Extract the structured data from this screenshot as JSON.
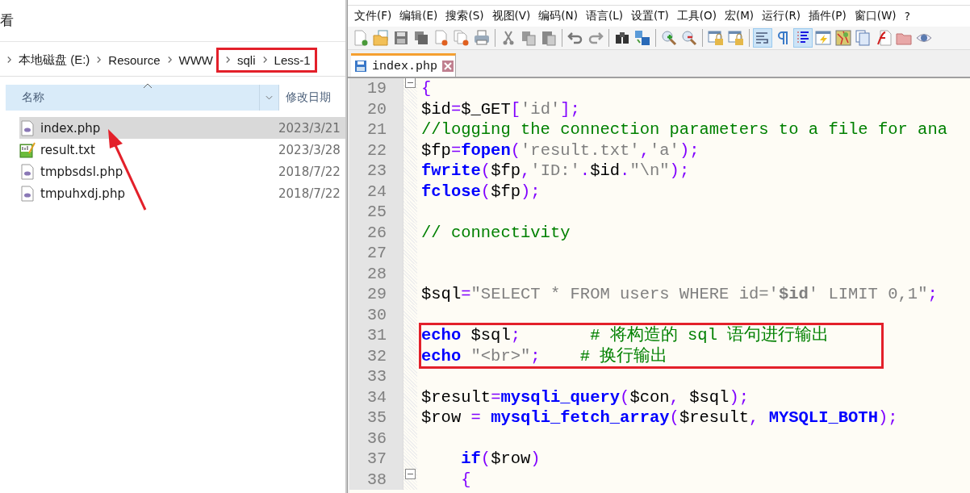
{
  "explorer": {
    "ribbon_tab": "看",
    "breadcrumb": [
      {
        "label": "本地磁盘 (E:)",
        "marked": false
      },
      {
        "label": "Resource",
        "marked": false
      },
      {
        "label": "WWW",
        "marked": false
      },
      {
        "label": "sqli",
        "marked": true
      },
      {
        "label": "Less-1",
        "marked": true
      }
    ],
    "columns": [
      "名称",
      "修改日期"
    ],
    "files": [
      {
        "name": "index.php",
        "date": "2023/3/21",
        "kind": "php",
        "selected": true,
        "pointed": true
      },
      {
        "name": "result.txt",
        "date": "2023/3/28",
        "kind": "txt",
        "selected": false,
        "pointed": false
      },
      {
        "name": "tmpbsdsl.php",
        "date": "2018/7/22",
        "kind": "php",
        "selected": false,
        "pointed": false
      },
      {
        "name": "tmpuhxdj.php",
        "date": "2018/7/22",
        "kind": "php",
        "selected": false,
        "pointed": false
      }
    ]
  },
  "editor": {
    "menu": [
      "文件(F)",
      "编辑(E)",
      "搜索(S)",
      "视图(V)",
      "编码(N)",
      "语言(L)",
      "设置(T)",
      "工具(O)",
      "宏(M)",
      "运行(R)",
      "插件(P)",
      "窗口(W)",
      "?"
    ],
    "toolbar": [
      {
        "kind": "new",
        "pressed": false
      },
      {
        "kind": "open",
        "pressed": false
      },
      {
        "kind": "save",
        "pressed": false
      },
      {
        "kind": "saveall",
        "pressed": false
      },
      {
        "kind": "close",
        "pressed": false
      },
      {
        "kind": "closeall",
        "pressed": false
      },
      {
        "kind": "print",
        "pressed": false
      },
      {
        "kind": "sep"
      },
      {
        "kind": "cut",
        "pressed": false
      },
      {
        "kind": "copy",
        "pressed": false
      },
      {
        "kind": "paste",
        "pressed": false
      },
      {
        "kind": "sep"
      },
      {
        "kind": "undo",
        "pressed": false
      },
      {
        "kind": "redo",
        "pressed": false
      },
      {
        "kind": "sep"
      },
      {
        "kind": "find",
        "pressed": false
      },
      {
        "kind": "replace",
        "pressed": false
      },
      {
        "kind": "sep"
      },
      {
        "kind": "zoomin",
        "pressed": false
      },
      {
        "kind": "zoomout",
        "pressed": false
      },
      {
        "kind": "sep"
      },
      {
        "kind": "lock",
        "pressed": false
      },
      {
        "kind": "lock",
        "pressed": false
      },
      {
        "kind": "sep"
      },
      {
        "kind": "wrap",
        "pressed": true
      },
      {
        "kind": "pilcrow",
        "pressed": false
      },
      {
        "kind": "guide",
        "pressed": true
      },
      {
        "kind": "bolt",
        "pressed": false
      },
      {
        "kind": "map",
        "pressed": false
      },
      {
        "kind": "docs",
        "pressed": false
      },
      {
        "kind": "func",
        "pressed": false
      },
      {
        "kind": "folder",
        "pressed": false
      },
      {
        "kind": "eye",
        "pressed": false
      }
    ],
    "tabs": [
      {
        "label": "index.php",
        "selected": true
      }
    ],
    "lines": [
      {
        "number": "19",
        "fold_start": true,
        "marked": false,
        "tokens": [
          {
            "op": "{"
          }
        ]
      },
      {
        "number": "20",
        "fold_start": false,
        "marked": false,
        "tokens": [
          {
            "plain": "$id"
          },
          {
            "op": "="
          },
          {
            "plain": "$_GET"
          },
          {
            "op": "["
          },
          {
            "str": "'id'"
          },
          {
            "op": "];"
          }
        ]
      },
      {
        "number": "21",
        "fold_start": false,
        "marked": false,
        "tokens": [
          {
            "cmt": "//logging the connection parameters to a file for ana"
          }
        ]
      },
      {
        "number": "22",
        "fold_start": false,
        "marked": false,
        "tokens": [
          {
            "plain": "$fp"
          },
          {
            "op": "="
          },
          {
            "kw": "fopen"
          },
          {
            "op": "("
          },
          {
            "str": "'result.txt'"
          },
          {
            "op": ","
          },
          {
            "str": "'a'"
          },
          {
            "op": ");"
          }
        ]
      },
      {
        "number": "23",
        "fold_start": false,
        "marked": false,
        "tokens": [
          {
            "kw": "fwrite"
          },
          {
            "op": "("
          },
          {
            "plain": "$fp"
          },
          {
            "op": ","
          },
          {
            "str": "'ID:'"
          },
          {
            "op": "."
          },
          {
            "plain": "$id"
          },
          {
            "op": "."
          },
          {
            "str": "\"\\n\""
          },
          {
            "op": ");"
          }
        ]
      },
      {
        "number": "24",
        "fold_start": false,
        "marked": false,
        "tokens": [
          {
            "kw": "fclose"
          },
          {
            "op": "("
          },
          {
            "plain": "$fp"
          },
          {
            "op": ");"
          }
        ]
      },
      {
        "number": "25",
        "fold_start": false,
        "marked": false
      },
      {
        "number": "26",
        "fold_start": false,
        "marked": false,
        "tokens": [
          {
            "cmt": "// connectivity"
          }
        ]
      },
      {
        "number": "27",
        "fold_start": false,
        "marked": false
      },
      {
        "number": "28",
        "fold_start": false,
        "marked": false
      },
      {
        "number": "29",
        "fold_start": false,
        "marked": false,
        "tokens": [
          {
            "plain": "$sql"
          },
          {
            "op": "="
          },
          {
            "str": "\"SELECT * FROM users WHERE id='"
          },
          {
            "strb": "$id"
          },
          {
            "str": "' LIMIT 0,1\""
          },
          {
            "op": ";"
          }
        ]
      },
      {
        "number": "30",
        "fold_start": false,
        "marked": false
      },
      {
        "number": "31",
        "fold_start": false,
        "marked": true,
        "tokens": [
          {
            "kw": "echo"
          },
          {
            "plain": " $sql"
          },
          {
            "op": ";"
          },
          {
            "cmt": "       # 将构造的 sql 语句进行输出"
          }
        ]
      },
      {
        "number": "32",
        "fold_start": false,
        "marked": true,
        "tokens": [
          {
            "kw": "echo"
          },
          {
            "str": " \"<br>\""
          },
          {
            "op": ";"
          },
          {
            "cmt": "    # 换行输出"
          }
        ]
      },
      {
        "number": "33",
        "fold_start": false,
        "marked": false
      },
      {
        "number": "34",
        "fold_start": false,
        "marked": false,
        "tokens": [
          {
            "plain": "$result"
          },
          {
            "op": "="
          },
          {
            "kw": "mysqli_query"
          },
          {
            "op": "("
          },
          {
            "plain": "$con"
          },
          {
            "op": ","
          },
          {
            "plain": " $sql"
          },
          {
            "op": ");"
          }
        ]
      },
      {
        "number": "35",
        "fold_start": false,
        "marked": false,
        "tokens": [
          {
            "plain": "$row "
          },
          {
            "op": "="
          },
          {
            "kw": " mysqli_fetch_array"
          },
          {
            "op": "("
          },
          {
            "plain": "$result"
          },
          {
            "op": ","
          },
          {
            "kw": " MYSQLI_BOTH"
          },
          {
            "op": ");"
          }
        ]
      },
      {
        "number": "36",
        "fold_start": false,
        "marked": false
      },
      {
        "number": "37",
        "fold_start": false,
        "marked": false,
        "tokens": [
          {
            "kw": "    if"
          },
          {
            "op": "("
          },
          {
            "plain": "$row"
          },
          {
            "op": ")"
          }
        ]
      },
      {
        "number": "38",
        "fold_start": true,
        "marked": false,
        "tokens": [
          {
            "op": "    {"
          }
        ]
      }
    ]
  }
}
